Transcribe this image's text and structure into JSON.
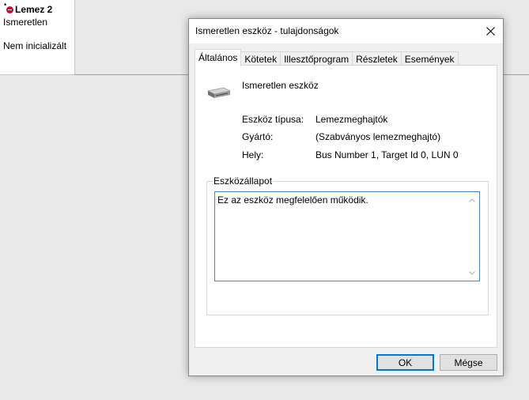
{
  "disk_panel": {
    "title": "Lemez 2",
    "type": "Ismeretlen",
    "state": "Nem inicializált",
    "marker": "*"
  },
  "dialog": {
    "title": "Ismeretlen eszköz - tulajdonságok",
    "tabs": [
      {
        "label": "Általános",
        "active": true
      },
      {
        "label": "Kötetek",
        "active": false
      },
      {
        "label": "Illesztőprogram",
        "active": false
      },
      {
        "label": "Részletek",
        "active": false
      },
      {
        "label": "Események",
        "active": false
      }
    ],
    "device_name": "Ismeretlen eszköz",
    "properties": [
      {
        "label": "Eszköz típusa:",
        "value": "Lemezmeghajtók"
      },
      {
        "label": "Gyártó:",
        "value": "(Szabványos lemezmeghajtó)"
      },
      {
        "label": "Hely:",
        "value": "Bus Number 1, Target Id 0, LUN 0"
      }
    ],
    "status_group_label": "Eszközállapot",
    "status_text": "Ez az eszköz megfelelően működik.",
    "ok_label": "OK",
    "cancel_label": "Mégse"
  },
  "colors": {
    "accent": "#0078d7",
    "status_icon": "#c8102e"
  },
  "icons": [
    "close-icon",
    "hard-disk-icon",
    "disk-error-icon",
    "scroll-up-icon",
    "scroll-down-icon"
  ]
}
